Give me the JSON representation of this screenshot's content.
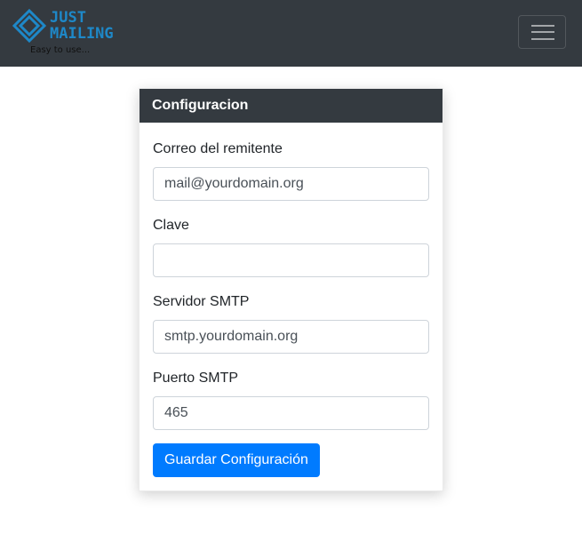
{
  "navbar": {
    "logo": {
      "line1": "JUST",
      "line2": "MAILING",
      "tagline": "Easy to use..."
    },
    "menu_icon": "hamburger-menu-icon"
  },
  "config_card": {
    "title": "Configuracion",
    "fields": [
      {
        "label": "Correo del remitente",
        "value": "mail@yourdomain.org",
        "placeholder": ""
      },
      {
        "label": "Clave",
        "value": "",
        "placeholder": ""
      },
      {
        "label": "Servidor SMTP",
        "value": "smtp.yourdomain.org",
        "placeholder": ""
      },
      {
        "label": "Puerto SMTP",
        "value": "465",
        "placeholder": ""
      }
    ],
    "save_label": "Guardar Configuración"
  },
  "colors": {
    "navbar_bg": "#343a40",
    "logo_accent": "#1e88c8",
    "primary": "#007bff"
  }
}
